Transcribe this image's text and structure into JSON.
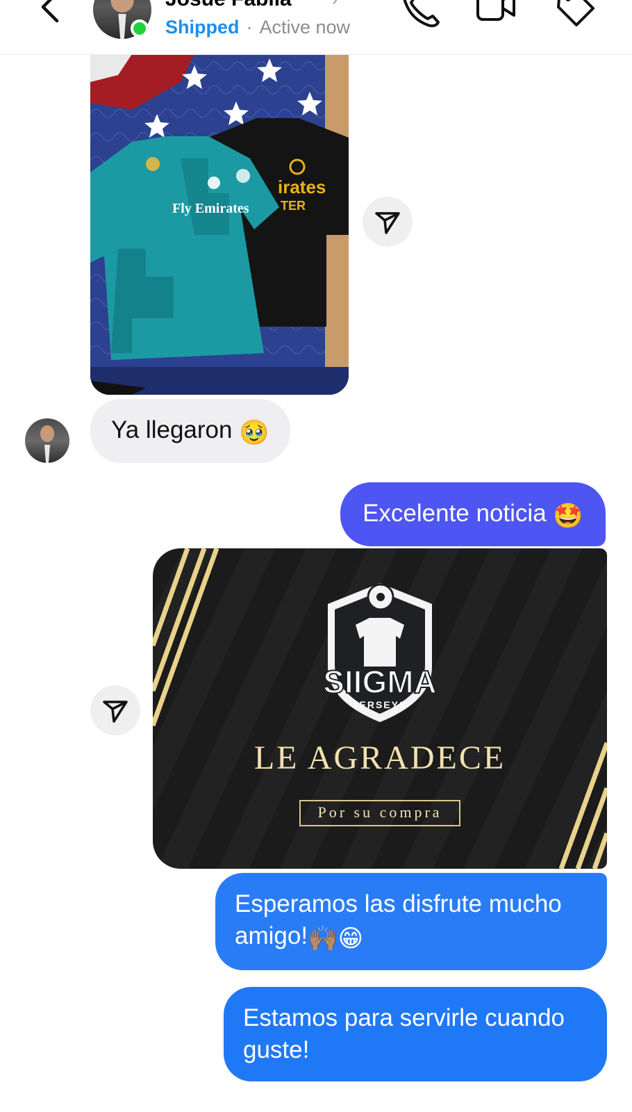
{
  "header": {
    "contact_name": "Josué Fabila",
    "status_shipped": "Shipped",
    "status_separator": "·",
    "status_active": "Active now",
    "icons": [
      "back-chevron-icon",
      "phone-icon",
      "video-camera-icon",
      "tag-icon"
    ]
  },
  "messages": {
    "incoming_text": "Ya llegaron",
    "incoming_emoji": "🥹",
    "out1_text": "Excelente noticia",
    "out1_emoji": "🤩",
    "out2_text": "Esperamos las disfrute mucho amigo!",
    "out2_emoji": "🙌🏽😁",
    "out3_text": "Estamos para servirle cuando guste!"
  },
  "photo": {
    "shirt1_text": "Fly Emirates",
    "shirt2_text": "irates"
  },
  "promo": {
    "brand": "SIIGMA",
    "brand_sub": "JERSEYS",
    "title": "LE AGRADECE",
    "subtitle": "Por su compra"
  },
  "colors": {
    "shipped_blue": "#1a8ef0",
    "online_green": "#1fd33a",
    "bubble_purple": "#4d55f2",
    "bubble_blue": "#2a7cf6",
    "promo_gold": "#f2e2b0"
  }
}
